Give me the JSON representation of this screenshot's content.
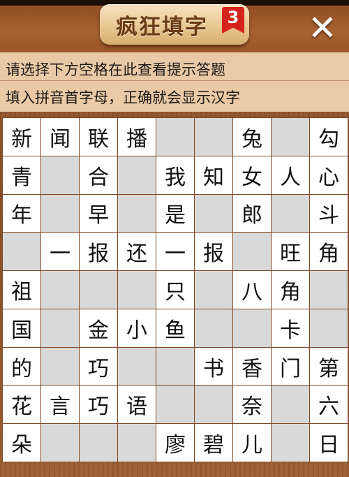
{
  "header": {
    "title": "疯狂填字",
    "level": "3",
    "close_label": "✕"
  },
  "hint": {
    "line1": "请选择下方空格在此查看提示答题",
    "line2": "填入拼音首字母，正确就会显示汉字"
  },
  "grid": {
    "rows": 9,
    "cols": 9,
    "cells": [
      [
        "新",
        "闻",
        "联",
        "播",
        "",
        "",
        "兔",
        "",
        "勾"
      ],
      [
        "青",
        "",
        "合",
        "",
        "我",
        "知",
        "女",
        "人",
        "心"
      ],
      [
        "年",
        "",
        "早",
        "",
        "是",
        "",
        "郎",
        "",
        "斗"
      ],
      [
        "",
        "一",
        "报",
        "还",
        "一",
        "报",
        "",
        "旺",
        "角"
      ],
      [
        "祖",
        "",
        "",
        "",
        "只",
        "",
        "八",
        "角",
        ""
      ],
      [
        "国",
        "",
        "金",
        "小",
        "鱼",
        "",
        "",
        "卡",
        ""
      ],
      [
        "的",
        "",
        "巧",
        "",
        "",
        "书",
        "香",
        "门",
        "第"
      ],
      [
        "花",
        "言",
        "巧",
        "语",
        "",
        "",
        "奈",
        "",
        "六"
      ],
      [
        "朵",
        "",
        "",
        "",
        "廖",
        "碧",
        "儿",
        "",
        "日"
      ]
    ]
  }
}
